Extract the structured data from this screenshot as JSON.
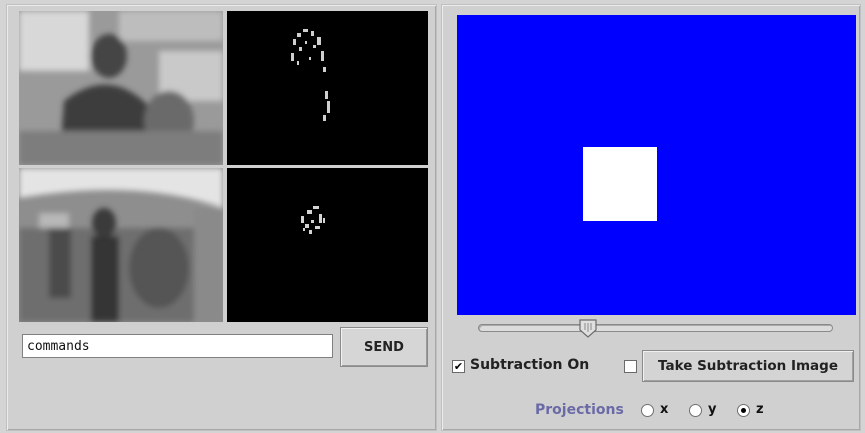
{
  "command": {
    "value": "commands",
    "send_label": "SEND"
  },
  "controls": {
    "subtraction_label": "Subtraction On",
    "subtraction_checked": true,
    "take_image_label": "Take Subtraction Image",
    "take_image_checked": false,
    "check_glyph": "✔"
  },
  "projections": {
    "label": "Projections",
    "options": [
      "x",
      "y",
      "z"
    ],
    "selected": "z"
  },
  "slider": {
    "value_fraction": 0.31
  },
  "colors": {
    "canvas_bg": "#0000fe",
    "object": "#ffffff",
    "panel_bg": "#d0d0d0"
  }
}
